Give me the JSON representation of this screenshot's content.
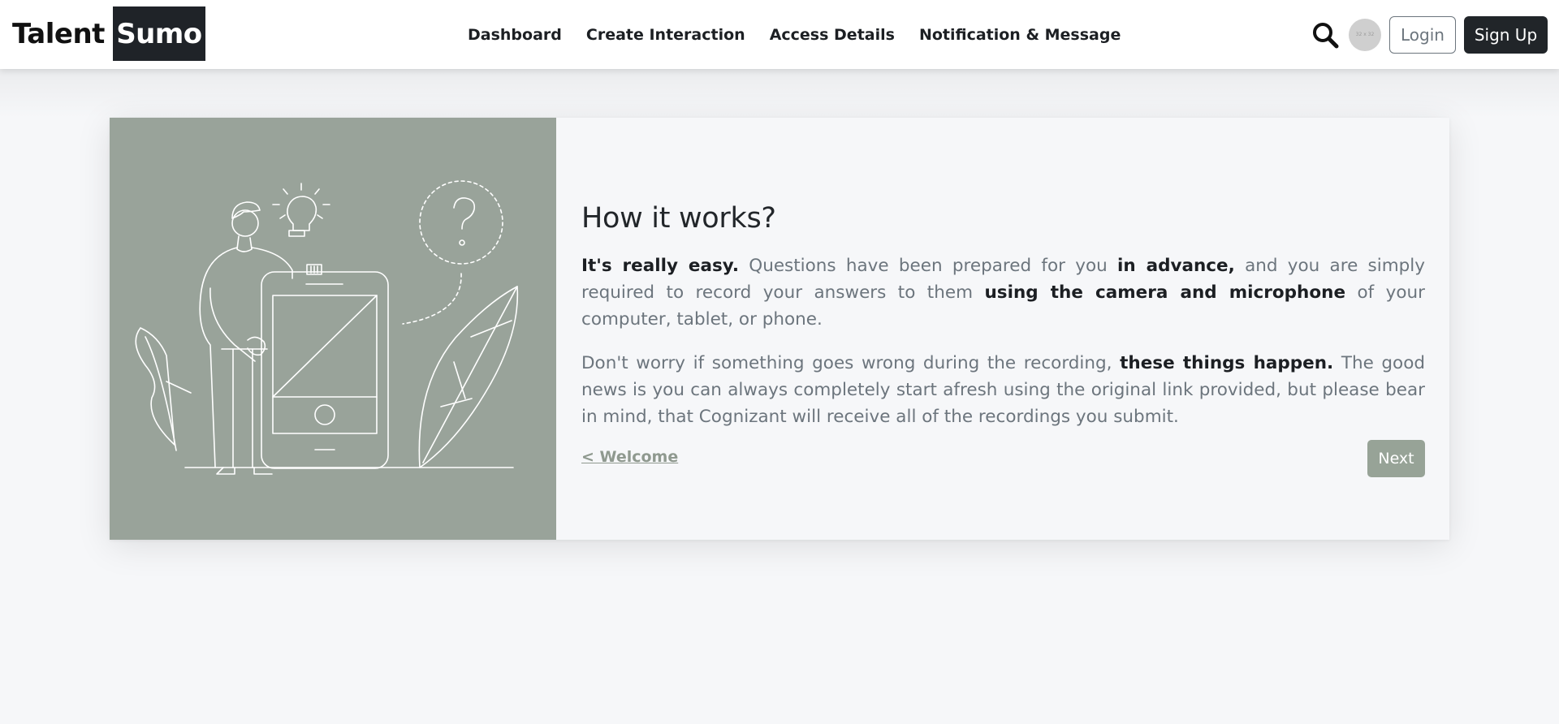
{
  "brand": {
    "part1": "Talent",
    "part2": "Sumo"
  },
  "nav": {
    "links": [
      "Dashboard",
      "Create Interaction",
      "Access Details",
      "Notification & Message"
    ],
    "login_label": "Login",
    "signup_label": "Sign Up",
    "search_icon": "search-icon",
    "avatar_text": "32 x 32"
  },
  "card": {
    "title": "How it works?",
    "para1": {
      "s1": "It's really easy.",
      "s2": " Questions have been prepared for you ",
      "s3": "in advance,",
      "s4": " and you are simply required to record your answers to them ",
      "s5": "using the camera and microphone",
      "s6": " of your computer, tablet, or phone."
    },
    "para2": {
      "s1": "Don't worry if something goes wrong during the recording, ",
      "s2": "these things happen.",
      "s3": " The good news is you can always completely start afresh using the original link provided, but please bear in mind, that Cognizant will receive all of the recordings you submit."
    },
    "back_label": "< Welcome",
    "next_label": "Next"
  },
  "colors": {
    "accent": "#99a39a",
    "dark": "#212529",
    "muted_text": "#6c757d"
  }
}
